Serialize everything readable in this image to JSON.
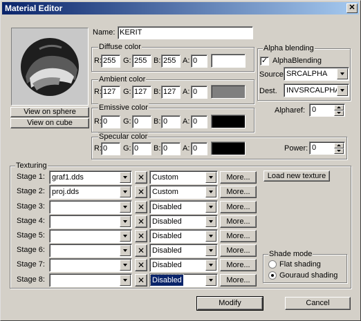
{
  "window": {
    "title": "Material Editor",
    "close_glyph": "✕"
  },
  "preview": {
    "view_sphere_label": "View on sphere",
    "view_cube_label": "View on cube"
  },
  "name": {
    "label": "Name:",
    "value": "KERIT"
  },
  "diffuse": {
    "title": "Diffuse color",
    "r_label": "R:",
    "g_label": "G:",
    "b_label": "B:",
    "a_label": "A:",
    "r": "255",
    "g": "255",
    "b": "255",
    "a": "0",
    "swatch": "#ffffff"
  },
  "ambient": {
    "title": "Ambient color",
    "r_label": "R:",
    "g_label": "G:",
    "b_label": "B:",
    "a_label": "A:",
    "r": "127",
    "g": "127",
    "b": "127",
    "a": "0",
    "swatch": "#7f7f7f"
  },
  "emissive": {
    "title": "Emissive color",
    "r_label": "R:",
    "g_label": "G:",
    "b_label": "B:",
    "a_label": "A:",
    "r": "0",
    "g": "0",
    "b": "0",
    "a": "0",
    "swatch": "#000000"
  },
  "specular": {
    "title": "Specular color",
    "r_label": "R:",
    "g_label": "G:",
    "b_label": "B:",
    "a_label": "A:",
    "r": "0",
    "g": "0",
    "b": "0",
    "a": "0",
    "swatch": "#000000"
  },
  "alpha": {
    "title": "Alpha blending",
    "checkbox_label": "AlphaBlending",
    "checked_glyph": "✓",
    "source_label": "Source",
    "source_value": "SRCALPHA",
    "dest_label": "Dest.",
    "dest_value": "INVSRCALPHA",
    "alpharef_label": "Alpharef:",
    "alpharef_value": "0"
  },
  "power": {
    "label": "Power:",
    "value": "0"
  },
  "texturing": {
    "title": "Texturing",
    "load_label": "Load new texture",
    "clear_glyph": "✕",
    "more_label": "More...",
    "stages": [
      {
        "label": "Stage 1:",
        "texture": "graf1.dds",
        "mode": "Custom"
      },
      {
        "label": "Stage 2:",
        "texture": "proj.dds",
        "mode": "Custom"
      },
      {
        "label": "Stage 3:",
        "texture": "",
        "mode": "Disabled"
      },
      {
        "label": "Stage 4:",
        "texture": "",
        "mode": "Disabled"
      },
      {
        "label": "Stage 5:",
        "texture": "",
        "mode": "Disabled"
      },
      {
        "label": "Stage 6:",
        "texture": "",
        "mode": "Disabled"
      },
      {
        "label": "Stage 7:",
        "texture": "",
        "mode": "Disabled"
      },
      {
        "label": "Stage 8:",
        "texture": "",
        "mode": "Disabled"
      }
    ]
  },
  "shade": {
    "title": "Shade mode",
    "flat_label": "Flat shading",
    "gouraud_label": "Gouraud shading",
    "selected": "gouraud"
  },
  "footer": {
    "modify_label": "Modify",
    "cancel_label": "Cancel"
  }
}
